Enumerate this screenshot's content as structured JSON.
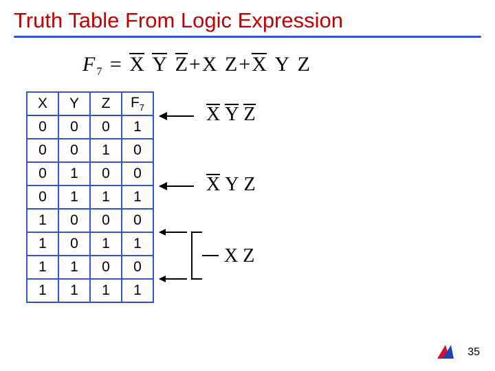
{
  "title": "Truth Table From Logic Expression",
  "expression": {
    "lhs_var": "F",
    "lhs_sub": "7",
    "eq": "=",
    "term1": {
      "xbar": "X",
      "ybar": "Y",
      "zbar": "Z"
    },
    "plus1": "+",
    "term2": {
      "x": "X",
      "z": "Z"
    },
    "plus2": "+",
    "term3": {
      "xbar": "X",
      "y": "Y",
      "z": "Z"
    }
  },
  "table": {
    "headers": [
      "X",
      "Y",
      "Z",
      "F",
      "7"
    ],
    "rows": [
      [
        "0",
        "0",
        "0",
        "1"
      ],
      [
        "0",
        "0",
        "1",
        "0"
      ],
      [
        "0",
        "1",
        "0",
        "0"
      ],
      [
        "0",
        "1",
        "1",
        "1"
      ],
      [
        "1",
        "0",
        "0",
        "0"
      ],
      [
        "1",
        "0",
        "1",
        "1"
      ],
      [
        "1",
        "1",
        "0",
        "0"
      ],
      [
        "1",
        "1",
        "1",
        "1"
      ]
    ]
  },
  "annotations": {
    "a1": {
      "xbar": "X",
      "ybar": "Y",
      "zbar": "Z"
    },
    "a2": {
      "xbar": "X",
      "y": "Y",
      "z": "Z"
    },
    "a3": {
      "x": "X",
      "z": "Z"
    }
  },
  "page_number": "35"
}
